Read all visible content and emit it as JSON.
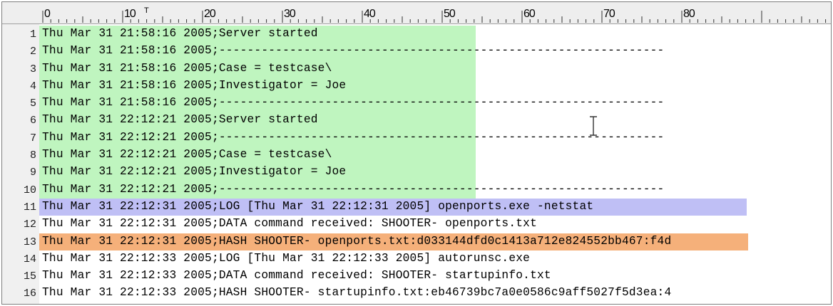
{
  "ruler": {
    "labels": [
      "0",
      "10",
      "20",
      "30",
      "40",
      "50",
      "60",
      "70",
      "80"
    ],
    "caret_mark": "T"
  },
  "colors": {
    "highlight_green": "#bff5bf",
    "highlight_violet": "#bfbff5",
    "highlight_orange": "#f5b07a"
  },
  "lines": [
    {
      "num": "1",
      "text": "Thu Mar 31 21:58:16 2005;Server started",
      "highlight": "green"
    },
    {
      "num": "2",
      "text": "Thu Mar 31 21:58:16 2005;---------------------------------------------------------------",
      "highlight": "green"
    },
    {
      "num": "3",
      "text": "Thu Mar 31 21:58:16 2005;Case = testcase\\",
      "highlight": "green"
    },
    {
      "num": "4",
      "text": "Thu Mar 31 21:58:16 2005;Investigator = Joe",
      "highlight": "green"
    },
    {
      "num": "5",
      "text": "Thu Mar 31 21:58:16 2005;---------------------------------------------------------------",
      "highlight": "green"
    },
    {
      "num": "6",
      "text": "Thu Mar 31 22:12:21 2005;Server started",
      "highlight": "green"
    },
    {
      "num": "7",
      "text": "Thu Mar 31 22:12:21 2005;---------------------------------------------------------------",
      "highlight": "green"
    },
    {
      "num": "8",
      "text": "Thu Mar 31 22:12:21 2005;Case = testcase\\",
      "highlight": "green"
    },
    {
      "num": "9",
      "text": "Thu Mar 31 22:12:21 2005;Investigator = Joe",
      "highlight": "green"
    },
    {
      "num": "10",
      "text": "Thu Mar 31 22:12:21 2005;---------------------------------------------------------------",
      "highlight": "green"
    },
    {
      "num": "11",
      "text": "Thu Mar 31 22:12:31 2005;LOG [Thu Mar 31 22:12:31 2005] openports.exe -netstat",
      "highlight": "violet"
    },
    {
      "num": "12",
      "text": "Thu Mar 31 22:12:31 2005;DATA command received: SHOOTER- openports.txt",
      "highlight": "none"
    },
    {
      "num": "13",
      "text": "Thu Mar 31 22:12:31 2005;HASH SHOOTER- openports.txt:d033144dfd0c1413a712e824552bb467:f4d",
      "highlight": "orange"
    },
    {
      "num": "14",
      "text": "Thu Mar 31 22:12:33 2005;LOG [Thu Mar 31 22:12:33 2005] autorunsc.exe",
      "highlight": "none"
    },
    {
      "num": "15",
      "text": "Thu Mar 31 22:12:33 2005;DATA command received: SHOOTER- startupinfo.txt",
      "highlight": "none"
    },
    {
      "num": "16",
      "text": "Thu Mar 31 22:12:33 2005;HASH SHOOTER- startupinfo.txt:eb46739bc7a0e0586c9aff5027f5d3ea:4",
      "highlight": "none"
    }
  ]
}
